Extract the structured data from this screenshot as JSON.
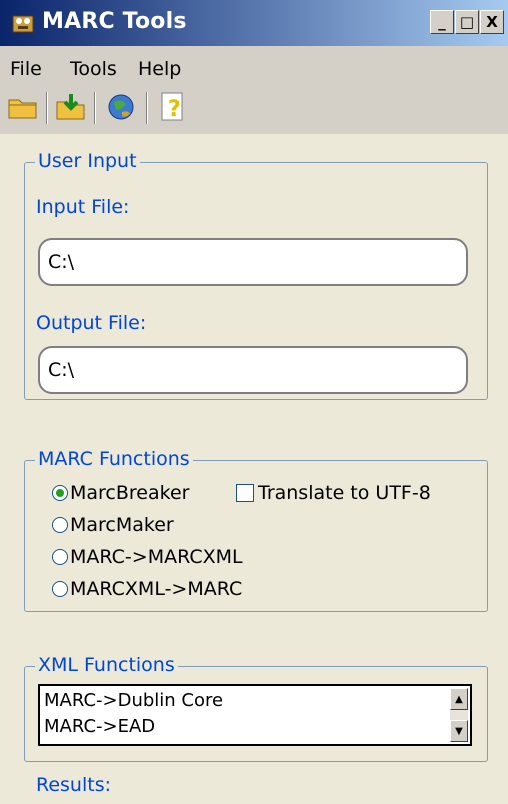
{
  "window": {
    "title": "MARC Tools",
    "minimize_label": "_",
    "maximize_label": "□",
    "close_label": "X"
  },
  "menu": {
    "items": [
      {
        "label": "File"
      },
      {
        "label": "Tools"
      },
      {
        "label": "Help"
      }
    ]
  },
  "toolbar": {
    "buttons": [
      "open-folder-icon",
      "export-icon",
      "globe-icon",
      "help-icon"
    ]
  },
  "user_input": {
    "group_title": "User Input",
    "input_label": "Input File:",
    "input_value": "C:\\",
    "output_label": "Output File:",
    "output_value": "C:\\"
  },
  "marc_functions": {
    "group_title": "MARC Functions",
    "options": [
      {
        "label": "MarcBreaker",
        "selected": true
      },
      {
        "label": "MarcMaker",
        "selected": false
      },
      {
        "label": "MARC->MARCXML",
        "selected": false
      },
      {
        "label": "MARCXML->MARC",
        "selected": false
      }
    ],
    "translate_label": "Translate to UTF-8",
    "translate_checked": false
  },
  "xml_functions": {
    "group_title": "XML Functions",
    "items": [
      "MARC->Dublin Core",
      "MARC->EAD"
    ]
  },
  "results": {
    "label": "Results:"
  },
  "colors": {
    "accent": "#0046d5",
    "title_bar_start": "#0a246a",
    "title_bar_end": "#a6caf0"
  }
}
